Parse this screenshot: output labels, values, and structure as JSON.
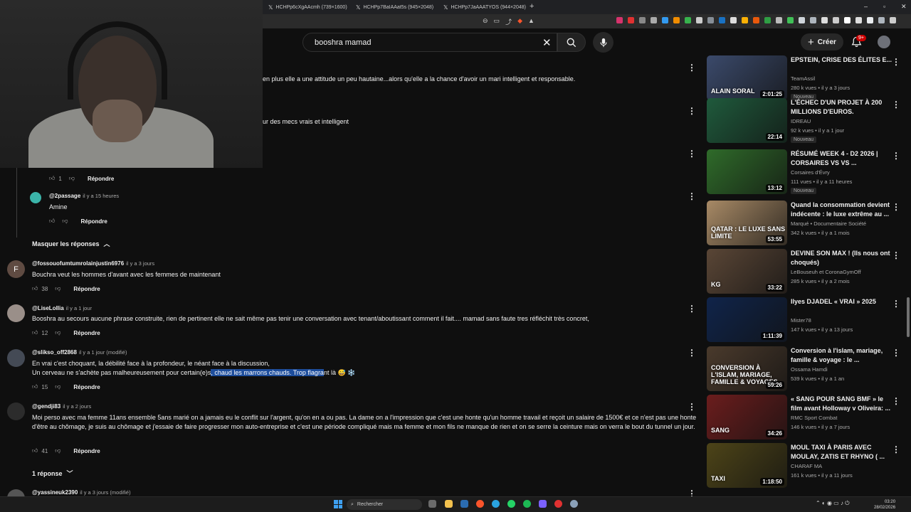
{
  "browser": {
    "tabs": [
      {
        "label": "HCHPp6cXgAAcmh (739×1600)"
      },
      {
        "label": "HCHPp7BaIAAat5s (945×2048)"
      },
      {
        "label": "HCHPp7JaAAATYOS (944×2048)"
      }
    ],
    "new_tab": "+",
    "window_controls": [
      "–",
      "▫",
      "✕"
    ]
  },
  "youtube": {
    "search_value": "booshra mamad",
    "create_label": "Créer",
    "notif_count": "9+"
  },
  "comments": {
    "partial_1": "en plus elle a une attitude un peu hautaine...alors qu'elle a la chance d'avoir un mari intelligent et responsable.",
    "partial_2": "ur des mecs vrais et intelligent",
    "partial_actions": {
      "likes": "1",
      "reply": "Répondre"
    },
    "reply_2passage": {
      "author": "@2passage",
      "time": "il y a 15 heures",
      "text": "Amine",
      "reply": "Répondre"
    },
    "hide_replies": "Masquer les réponses",
    "items": [
      {
        "author": "@fossouofumtumrolainjustin6976",
        "time": "il y a 3 jours",
        "initial": "F",
        "text": "Bouchra veut les hommes d'avant avec les femmes de maintenant",
        "likes": "38",
        "reply": "Répondre"
      },
      {
        "author": "@LiseLollia",
        "time": "il y a 1 jour",
        "text": "Booshra au secours aucune phrase construite, rien de pertinent elle ne sait même pas tenir une conversation avec tenant/aboutissant comment il fait.... mamad sans faute tres réfléchit très concret,",
        "likes": "12",
        "reply": "Répondre"
      },
      {
        "author": "@slikso_off2868",
        "time": "il y a 1 jour (modifié)",
        "line1": "En vrai c'est choquant, la débilité face à la profondeur, le néant face à la discussion,",
        "line2_pre": "Un cerveau ne s'achète pas malheureusement pour certain(e)s",
        "line2_hl": ", chaud les marrons chauds.  Trop flagra",
        "line2_post": "nt là 😅  ❄️",
        "likes": "15",
        "reply": "Répondre"
      },
      {
        "author": "@gendji83",
        "time": "il y a 2 jours",
        "text": "Moi perso avec ma femme 11ans ensemble 5ans marié on a jamais eu le conflit sur l'argent, qu'on en a ou pas. La dame on a l'impression que c'est une honte qu'un homme travail et reçoit un salaire de 1500€ et ce n'est pas une honte d'être au chômage, je suis au chômage et j'essaie de faire progresser mon auto-entreprise et c'est une période compliqué mais ma femme et mon fils ne manque de rien et on se serre la ceinture mais on verra le bout du tunnel un jour.",
        "likes": "41",
        "reply": "Répondre"
      },
      {
        "author": "@yassineuk2390",
        "time": "il y a 3 jours (modifié)"
      }
    ],
    "one_reply": "1 réponse"
  },
  "sidebar": {
    "videos": [
      {
        "title": "EPSTEIN, CRISE DES ÉLITES E...",
        "channel": "TeamAssil",
        "meta": "280 k vues • il y a 3 jours",
        "badge": "Nouveau",
        "duration": "2:01:25",
        "thumb_text": "ALAIN SORAL",
        "color": "#3b4a6b"
      },
      {
        "title": "L'ÉCHEC D'UN PROJET À 200 MILLIONS D'EUROS.",
        "channel": "IDREAU",
        "meta": "92 k vues • il y a 1 jour",
        "badge": "Nouveau",
        "duration": "22:14",
        "thumb_text": "",
        "color": "#1f5a3c"
      },
      {
        "title": "RÉSUMÉ WEEK 4 - D2 2026 | CORSAIRES VS  VS ...",
        "channel": "Corsaires d'Évry",
        "meta": "111 vues • il y a 11 heures",
        "badge": "Nouveau",
        "duration": "13:12",
        "thumb_text": "",
        "color": "#2f6b2a"
      },
      {
        "title": "Quand la consommation devient indécente : le luxe extrême au ...",
        "channel": "Marqué • Documentaire Société",
        "meta": "342 k vues • il y a 1 mois",
        "badge": "",
        "duration": "53:55",
        "thumb_text": "QATAR : LE LUXE SANS LIMITE",
        "color": "#a88a66"
      },
      {
        "title": "DEVINE SON MAX ! (Ils nous ont choqués)",
        "channel": "LeBouseuh  et CoronaGymOff",
        "meta": "285 k vues • il y a 2 mois",
        "badge": "",
        "duration": "33:22",
        "thumb_text": "KG",
        "color": "#5a4636"
      },
      {
        "title": "Ilyes DJADEL  « VRAI » 2025",
        "channel": "Mister78",
        "meta": "147 k vues • il y a 13 jours",
        "badge": "",
        "duration": "1:11:39",
        "thumb_text": "",
        "color": "#10244a"
      },
      {
        "title": "Conversion à l'islam, mariage, famille & voyage : le ...",
        "channel": "Ossama Hamdi",
        "meta": "539 k vues • il y a 1 an",
        "badge": "",
        "duration": "59:26",
        "thumb_text": "CONVERSION À L'ISLAM, MARIAGE, FAMILLE & VOYAGES",
        "color": "#4a3a2c"
      },
      {
        "title": "« SANG POUR SANG BMF » le film avant Holloway v Oliveira: ...",
        "channel": "RMC Sport Combat",
        "meta": "146 k vues • il y a 7 jours",
        "badge": "",
        "duration": "34:26",
        "thumb_text": "SANG",
        "color": "#6b1d1d"
      },
      {
        "title": "MOUL TAXI À PARIS AVEC MOULAY, ZATIS ET RHYNO ( ...",
        "channel": "CHARAF MA",
        "meta": "161 k vues • il y a 11 jours",
        "badge": "",
        "duration": "1:18:50",
        "thumb_text": "TAXI",
        "color": "#4d4418"
      }
    ]
  },
  "taskbar": {
    "search_placeholder": "Rechercher",
    "time": "03:20",
    "date": "28/02/2026"
  }
}
